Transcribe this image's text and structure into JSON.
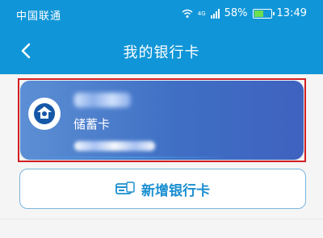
{
  "status_bar": {
    "carrier": "中国联通",
    "network": "4G",
    "battery": "58%",
    "time": "13:49"
  },
  "header": {
    "title": "我的银行卡",
    "back_icon": "chevron-left-icon"
  },
  "card": {
    "type_label": "储蓄卡",
    "bank_name": "",
    "card_number": ""
  },
  "actions": {
    "add_card_label": "新增银行卡"
  },
  "colors": {
    "header_blue": "#1096d8",
    "highlight_red": "#d32023",
    "button_blue": "#1b8fd0"
  }
}
